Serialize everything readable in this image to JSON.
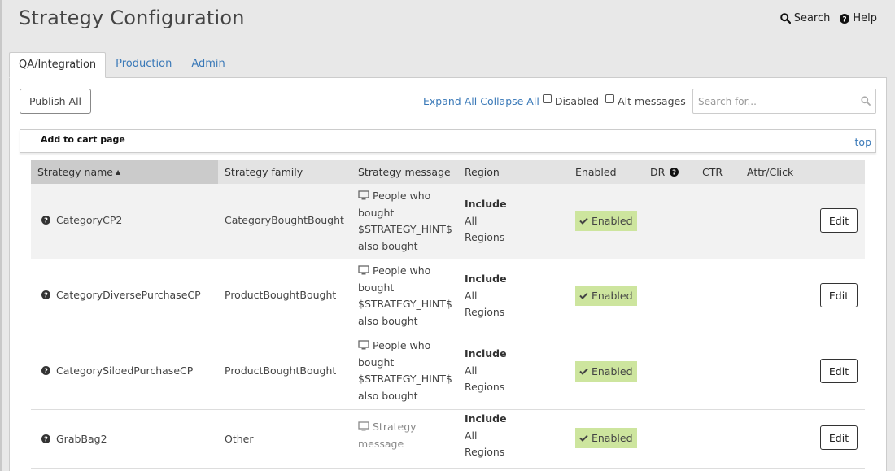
{
  "header": {
    "title": "Strategy Configuration",
    "search_label": "Search",
    "help_label": "Help"
  },
  "tabs": [
    {
      "label": "QA/Integration",
      "active": true
    },
    {
      "label": "Production",
      "active": false
    },
    {
      "label": "Admin",
      "active": false
    }
  ],
  "toolbar": {
    "publish_label": "Publish All",
    "expand_label": "Expand All",
    "collapse_label": "Collapse All",
    "disabled_label": "Disabled",
    "alt_messages_label": "Alt messages",
    "search_placeholder": "Search for..."
  },
  "section": {
    "title": "Add to cart page",
    "top_label": "top"
  },
  "table": {
    "columns": {
      "name": "Strategy name",
      "family": "Strategy family",
      "message": "Strategy message",
      "region": "Region",
      "enabled": "Enabled",
      "dr": "DR",
      "ctr": "CTR",
      "attr": "Attr/Click"
    },
    "rows": [
      {
        "name": "CategoryCP2",
        "family": "CategoryBoughtBought",
        "message_lines": [
          "People who",
          "bought",
          "$STRATEGY_HINT$",
          "also bought"
        ],
        "region_mode": "Include",
        "region_lines": [
          "All",
          "Regions"
        ],
        "enabled_label": "Enabled",
        "edit_label": "Edit"
      },
      {
        "name": "CategoryDiversePurchaseCP",
        "family": "ProductBoughtBought",
        "message_lines": [
          "People who",
          "bought",
          "$STRATEGY_HINT$",
          "also bought"
        ],
        "region_mode": "Include",
        "region_lines": [
          "All",
          "Regions"
        ],
        "enabled_label": "Enabled",
        "edit_label": "Edit"
      },
      {
        "name": "CategorySiloedPurchaseCP",
        "family": "ProductBoughtBought",
        "message_lines": [
          "People who",
          "bought",
          "$STRATEGY_HINT$",
          "also bought"
        ],
        "region_mode": "Include",
        "region_lines": [
          "All",
          "Regions"
        ],
        "enabled_label": "Enabled",
        "edit_label": "Edit"
      },
      {
        "name": "GrabBag2",
        "family": "Other",
        "message_lines": [
          "Strategy",
          "message"
        ],
        "region_mode": "Include",
        "region_lines": [
          "All",
          "Regions"
        ],
        "enabled_label": "Enabled",
        "edit_label": "Edit"
      }
    ]
  },
  "colors": {
    "link": "#3a79b8",
    "enabled_badge": "#cde59e",
    "sorted_header": "#cbcbcb"
  }
}
